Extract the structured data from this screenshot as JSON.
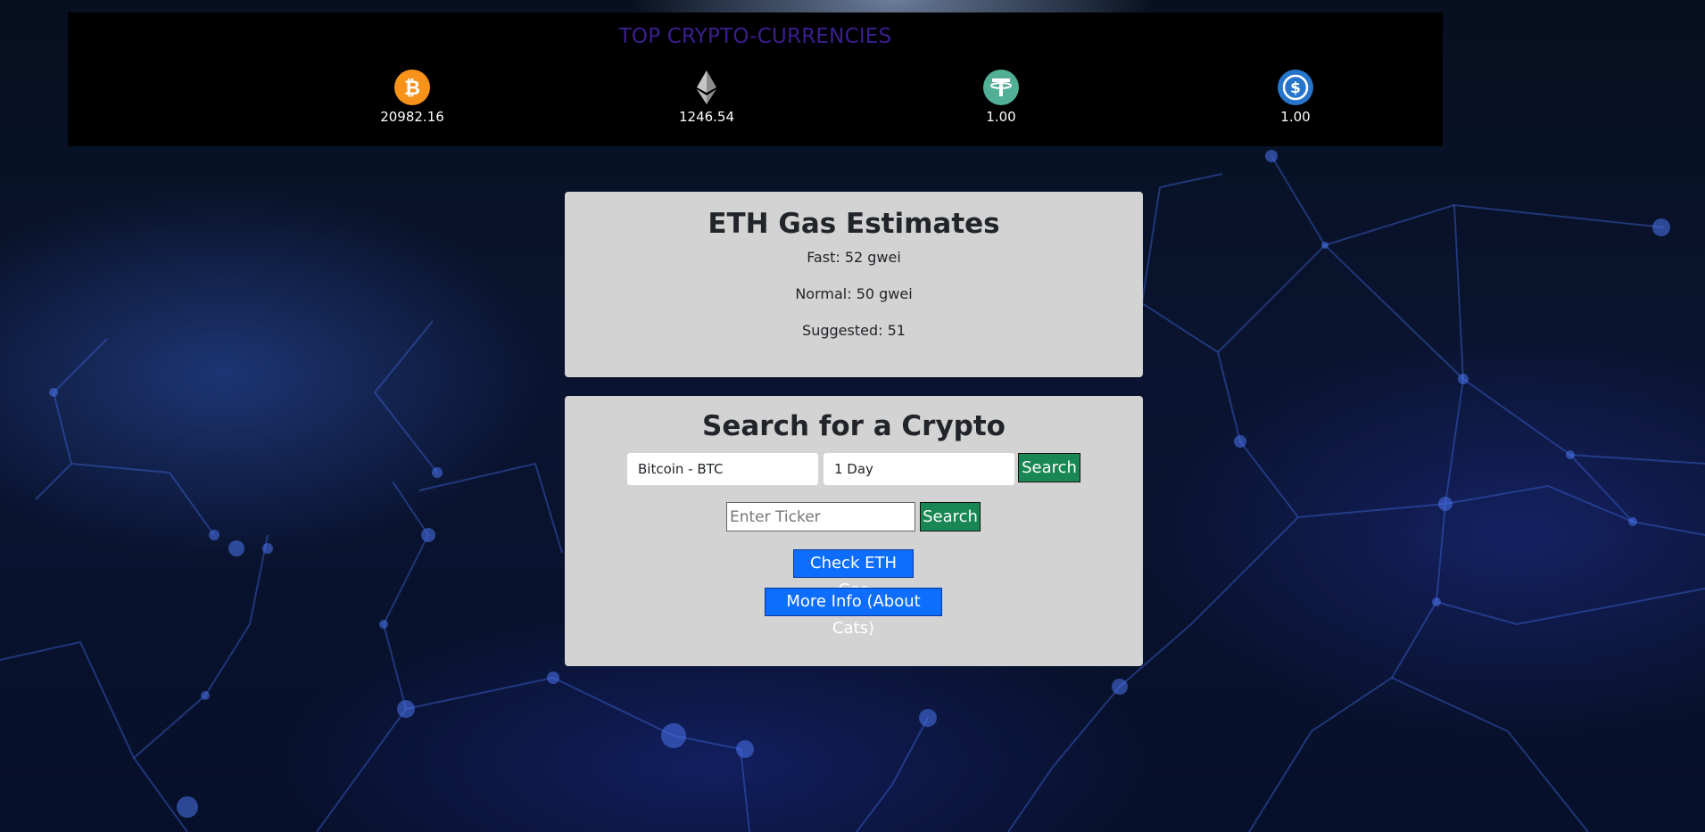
{
  "header": {
    "title": "TOP CRYPTO-CURRENCIES",
    "coins": [
      {
        "icon": "bitcoin-icon",
        "price": "20982.16",
        "color": "#f7931a"
      },
      {
        "icon": "ethereum-icon",
        "price": "1246.54",
        "color": "#627eea"
      },
      {
        "icon": "tether-icon",
        "price": "1.00",
        "color": "#50af95"
      },
      {
        "icon": "usd-coin-icon",
        "price": "1.00",
        "color": "#2775ca"
      }
    ]
  },
  "gas": {
    "title": "ETH Gas Estimates",
    "fast": "Fast: 52 gwei",
    "normal": "Normal: 50 gwei",
    "suggested": "Suggested: 51"
  },
  "search": {
    "title": "Search for a Crypto",
    "crypto_select": "Bitcoin - BTC",
    "period_select": "1 Day",
    "search_label": "Search",
    "ticker_placeholder": "Enter Ticker",
    "ticker_search_label": "Search",
    "check_gas_label": "Check ETH Gas",
    "more_info_label": "More Info (About Cats)"
  },
  "colors": {
    "panel_bg": "#d3d3d3",
    "green_button": "#198754",
    "blue_button": "#0d6efd",
    "title_purple": "#3b1f8f"
  }
}
